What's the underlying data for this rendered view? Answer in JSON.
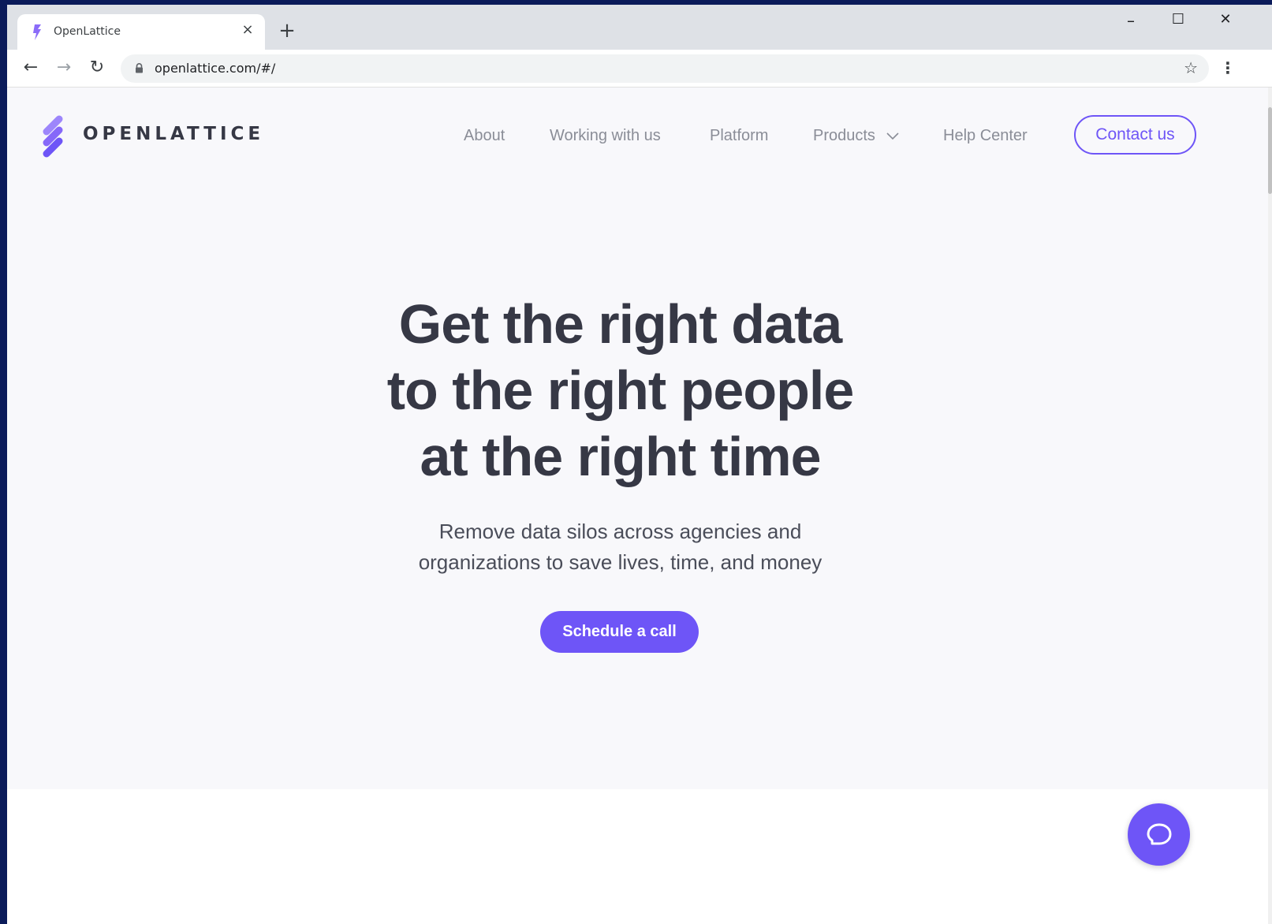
{
  "browser": {
    "tab_title": "OpenLattice",
    "tab_close": "×",
    "new_tab": "+",
    "url": "openlattice.com/#/",
    "window_controls": {
      "minimize": "–",
      "maximize": "☐",
      "close": "✕"
    },
    "nav": {
      "back": "←",
      "forward": "→",
      "reload": "↻",
      "bookmark": "☆",
      "menu": "⋮"
    }
  },
  "site": {
    "logo_text": "OPENLATTICE",
    "nav_links": [
      "About",
      "Working with us",
      "Platform",
      "Products",
      "Help Center"
    ],
    "contact_label": "Contact us",
    "headline_lines": [
      "Get the right data",
      "to the right people",
      "at the right time"
    ],
    "subhead_lines": [
      "Remove data silos across agencies and",
      "organizations to save lives, time, and money"
    ],
    "cta_label": "Schedule a call"
  },
  "colors": {
    "accent": "#6e55f7",
    "heading": "#363845",
    "hero_bg": "#f8f8fb",
    "nav_text": "#8a8d97"
  },
  "icons": {
    "favicon": "openlattice-logo-icon",
    "lock": "lock-icon",
    "chat": "chat-bubble-icon",
    "products_dropdown": "chevron-down-icon"
  }
}
